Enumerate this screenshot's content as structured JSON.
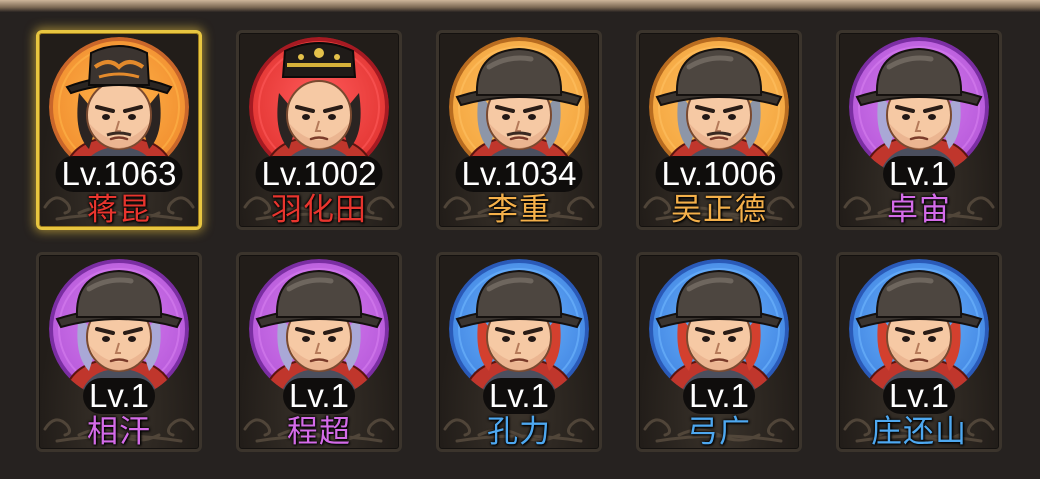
{
  "heroes": [
    {
      "level": "Lv.1063",
      "name": "蒋昆",
      "name_color": "#e8352e",
      "ring": "#ffb64a",
      "ring_dark": "#c9662a",
      "bg": "#f08a2d",
      "hat": "ornate",
      "hair": "dark",
      "selected": true
    },
    {
      "level": "Lv.1002",
      "name": "羽化田",
      "name_color": "#e8352e",
      "ring": "#ff5a5a",
      "ring_dark": "#a61a22",
      "bg": "#e0322f",
      "hat": "crown",
      "hair": "dark",
      "selected": false
    },
    {
      "level": "Lv.1034",
      "name": "李重",
      "name_color": "#f4b04a",
      "ring": "#ffc162",
      "ring_dark": "#b86c20",
      "bg": "#f3a43d",
      "hat": "guard",
      "hair": "grey",
      "selected": false
    },
    {
      "level": "Lv.1006",
      "name": "吴正德",
      "name_color": "#f4b04a",
      "ring": "#ffc162",
      "ring_dark": "#b86c20",
      "bg": "#f3a43d",
      "hat": "guard",
      "hair": "grey",
      "selected": false
    },
    {
      "level": "Lv.1",
      "name": "卓宙",
      "name_color": "#d46be8",
      "ring": "#d77ef0",
      "ring_dark": "#7b2ea3",
      "bg": "#b456d8",
      "hat": "helmet",
      "hair": "lavender",
      "selected": false
    },
    {
      "level": "Lv.1",
      "name": "相汗",
      "name_color": "#d46be8",
      "ring": "#d77ef0",
      "ring_dark": "#7b2ea3",
      "bg": "#b456d8",
      "hat": "helmet",
      "hair": "lavender",
      "selected": false
    },
    {
      "level": "Lv.1",
      "name": "程超",
      "name_color": "#d46be8",
      "ring": "#d77ef0",
      "ring_dark": "#7b2ea3",
      "bg": "#b456d8",
      "hat": "helmet",
      "hair": "lavender",
      "selected": false
    },
    {
      "level": "Lv.1",
      "name": "孔力",
      "name_color": "#4ea8f0",
      "ring": "#6fb8ff",
      "ring_dark": "#2a5ab8",
      "bg": "#3f82e0",
      "hat": "helmet",
      "hair": "red",
      "selected": false
    },
    {
      "level": "Lv.1",
      "name": "弓广",
      "name_color": "#4ea8f0",
      "ring": "#6fb8ff",
      "ring_dark": "#2a5ab8",
      "bg": "#3f82e0",
      "hat": "helmet",
      "hair": "red",
      "selected": false
    },
    {
      "level": "Lv.1",
      "name": "庄还山",
      "name_color": "#4ea8f0",
      "ring": "#6fb8ff",
      "ring_dark": "#2a5ab8",
      "bg": "#3f82e0",
      "hat": "helmet",
      "hair": "red",
      "selected": false
    }
  ]
}
